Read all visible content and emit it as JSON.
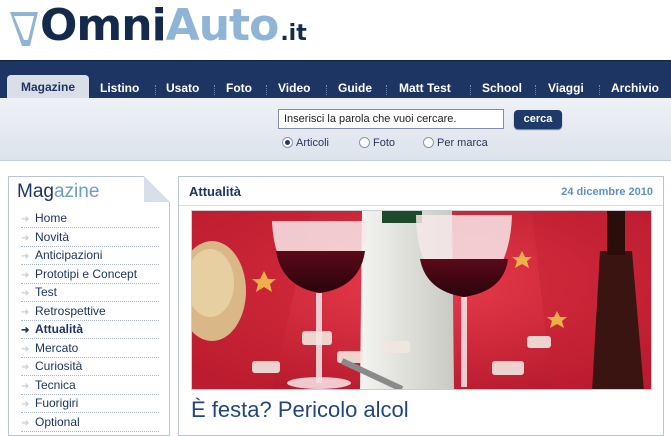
{
  "logo": {
    "omni": "Omni",
    "auto": "Auto",
    "tld": ".it"
  },
  "nav": {
    "items": [
      {
        "label": "Magazine",
        "active": true
      },
      {
        "label": "Listino"
      },
      {
        "label": "Usato"
      },
      {
        "label": "Foto"
      },
      {
        "label": "Video"
      },
      {
        "label": "Guide"
      },
      {
        "label": "Matt Test"
      },
      {
        "label": "School"
      },
      {
        "label": "Viaggi"
      },
      {
        "label": "Archivio"
      }
    ]
  },
  "search": {
    "value": "Inserisci la parola che vuoi cercare.",
    "button": "cerca",
    "options": [
      {
        "label": "Articoli",
        "selected": true
      },
      {
        "label": "Foto",
        "selected": false
      },
      {
        "label": "Per marca",
        "selected": false
      }
    ]
  },
  "sidebar": {
    "title_a": "Mag",
    "title_b": "azine",
    "items": [
      {
        "label": "Home"
      },
      {
        "label": "Novità"
      },
      {
        "label": "Anticipazioni"
      },
      {
        "label": "Prototipi e Concept"
      },
      {
        "label": "Test"
      },
      {
        "label": "Retrospettive"
      },
      {
        "label": "Attualità",
        "active": true
      },
      {
        "label": "Mercato"
      },
      {
        "label": "Curiosità"
      },
      {
        "label": "Tecnica"
      },
      {
        "label": "Fuorigiri"
      },
      {
        "label": "Optional"
      }
    ]
  },
  "main": {
    "section": "Attualità",
    "date": "24 dicembre 2010",
    "article_title": "È festa? Pericolo alcol"
  },
  "colors": {
    "navy": "#1c3563",
    "accent_blue": "#5d91c4",
    "photo_red": "#d8283c"
  }
}
